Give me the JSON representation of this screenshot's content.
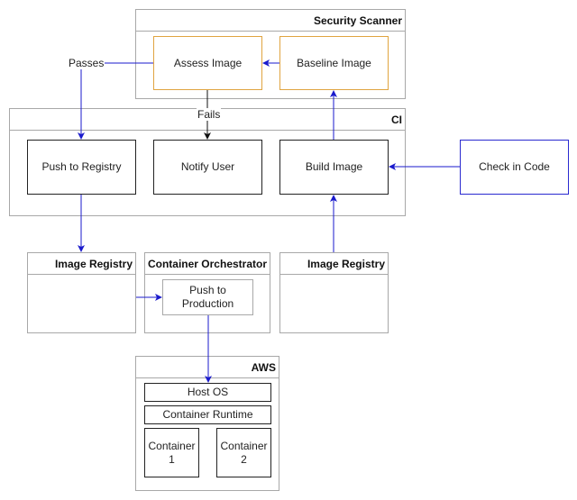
{
  "colors": {
    "blue_edge": "#1a1acc",
    "black_edge": "#111111",
    "orange_border": "#e0a440",
    "group_border": "#a8a8a8"
  },
  "groups": {
    "security_scanner": "Security Scanner",
    "ci": "CI",
    "image_registry_left": "Image Registry",
    "container_orchestrator": "Container Orchestrator",
    "image_registry_right": "Image Registry",
    "aws": "AWS"
  },
  "nodes": {
    "assess_image": "Assess Image",
    "baseline_image": "Baseline Image",
    "push_to_registry": "Push to Registry",
    "notify_user": "Notify User",
    "build_image": "Build Image",
    "check_in_code": "Check in Code",
    "push_to_production_1": "Push to",
    "push_to_production_2": "Production",
    "host_os": "Host OS",
    "container_runtime": "Container Runtime",
    "container_1_a": "Container",
    "container_1_b": "1",
    "container_2_a": "Container",
    "container_2_b": "2"
  },
  "edge_labels": {
    "passes": "Passes",
    "fails": "Fails"
  }
}
